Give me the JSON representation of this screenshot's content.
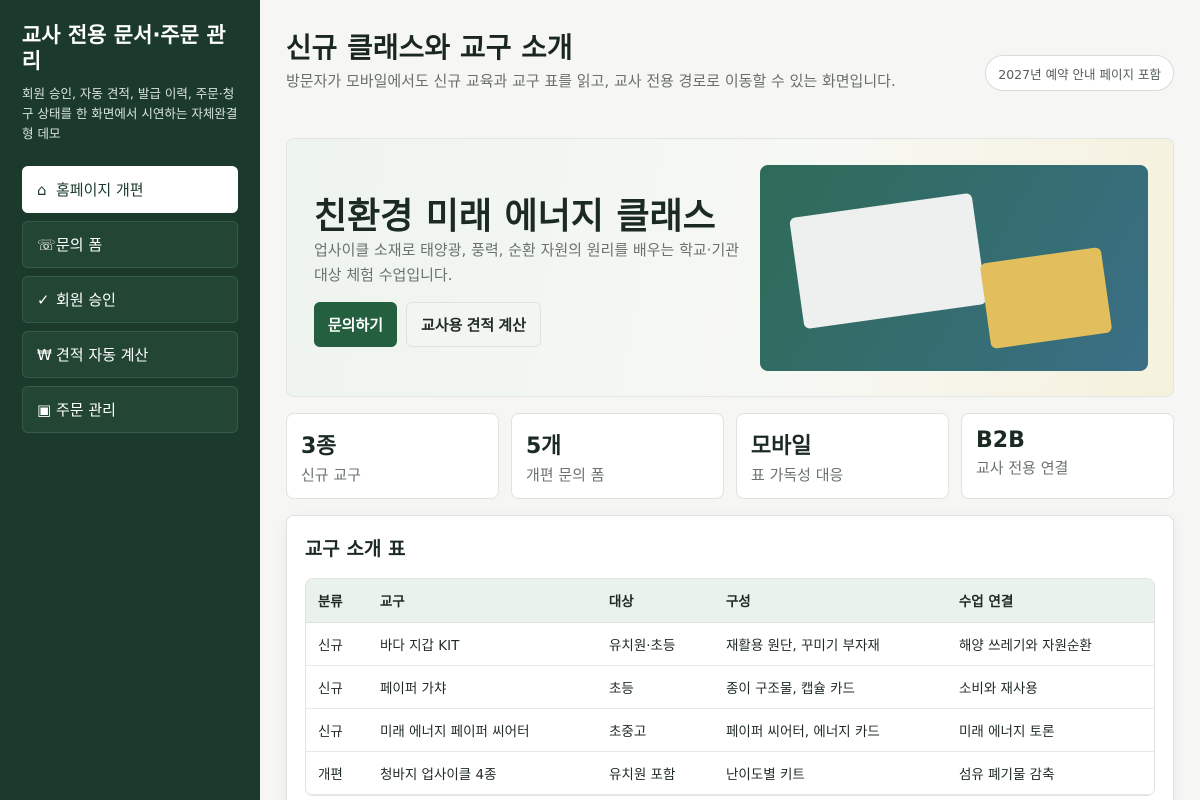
{
  "sidebar": {
    "title": "교사 전용 문서·주문 관리",
    "description": "회원 승인, 자동 견적, 발급 이력, 주문·청구 상태를 한 화면에서 시연하는 자체완결형 데모",
    "items": [
      {
        "icon": "⌂",
        "label": "홈페이지 개편"
      },
      {
        "icon": "☏",
        "label": "문의 폼"
      },
      {
        "icon": "✓",
        "label": "회원 승인"
      },
      {
        "icon": "₩",
        "label": "견적 자동 계산"
      },
      {
        "icon": "▣",
        "label": "주문 관리"
      }
    ]
  },
  "header": {
    "title": "신규 클래스와 교구 소개",
    "subtitle": "방문자가 모바일에서도 신규 교육과 교구 표를 읽고, 교사 전용 경로로 이동할 수 있는 화면입니다.",
    "notice": "2027년 예약 안내 페이지 포함"
  },
  "hero": {
    "title": "친환경 미래 에너지 클래스",
    "description": "업사이클 소재로 태양광, 풍력, 순환 자원의 원리를 배우는 학교·기관 대상 체험 수업입니다.",
    "primary_button": "문의하기",
    "secondary_button": "교사용 견적 계산"
  },
  "stats": [
    {
      "value": "3종",
      "label": "신규 교구"
    },
    {
      "value": "5개",
      "label": "개편 문의 폼"
    },
    {
      "value": "모바일",
      "label": "표 가독성 대응"
    },
    {
      "value": "B2B",
      "label": "교사 전용 연결"
    }
  ],
  "table": {
    "title": "교구 소개 표",
    "headers": [
      "분류",
      "교구",
      "대상",
      "구성",
      "수업 연결"
    ],
    "rows": [
      [
        "신규",
        "바다 지갑 KIT",
        "유치원·초등",
        "재활용 원단, 꾸미기 부자재",
        "해양 쓰레기와 자원순환"
      ],
      [
        "신규",
        "페이퍼 가챠",
        "초등",
        "종이 구조물, 캡슐 카드",
        "소비와 재사용"
      ],
      [
        "신규",
        "미래 에너지 페이퍼 씨어터",
        "초중고",
        "페이퍼 씨어터, 에너지 카드",
        "미래 에너지 토론"
      ],
      [
        "개편",
        "청바지 업사이클 4종",
        "유치원 포함",
        "난이도별 키트",
        "섬유 폐기물 감축"
      ]
    ]
  },
  "colors": {
    "sidebar_bg": "#1b3a2b",
    "primary": "#24603f",
    "accent_yellow": "#e2bf5c"
  }
}
